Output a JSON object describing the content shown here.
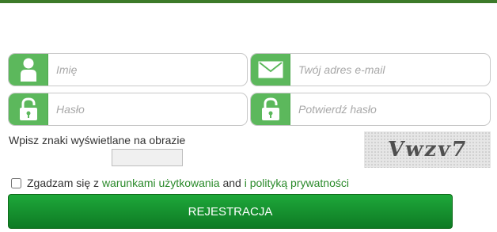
{
  "form": {
    "name_placeholder": "Imię",
    "email_placeholder": "Twój adres e-mail",
    "password_placeholder": "Hasło",
    "confirm_placeholder": "Potwierdź hasło",
    "icons": {
      "name": "user-icon",
      "email": "envelope-icon",
      "password": "lock-icon",
      "confirm": "lock-icon"
    }
  },
  "captcha": {
    "label": "Wpisz znaki wyświetlane na obrazie",
    "image_text": "Vwzv7"
  },
  "agree": {
    "prefix": "Zgadzam się z",
    "terms_link": "warunkami użytkowania",
    "and": "and",
    "privacy_link": "i polityką prywatności"
  },
  "submit": {
    "label": "REJESTRACJA"
  },
  "colors": {
    "accent": "#5cb85c",
    "button": "#149231",
    "link": "#2a8a2a",
    "top_bar": "#3d7a2a"
  }
}
